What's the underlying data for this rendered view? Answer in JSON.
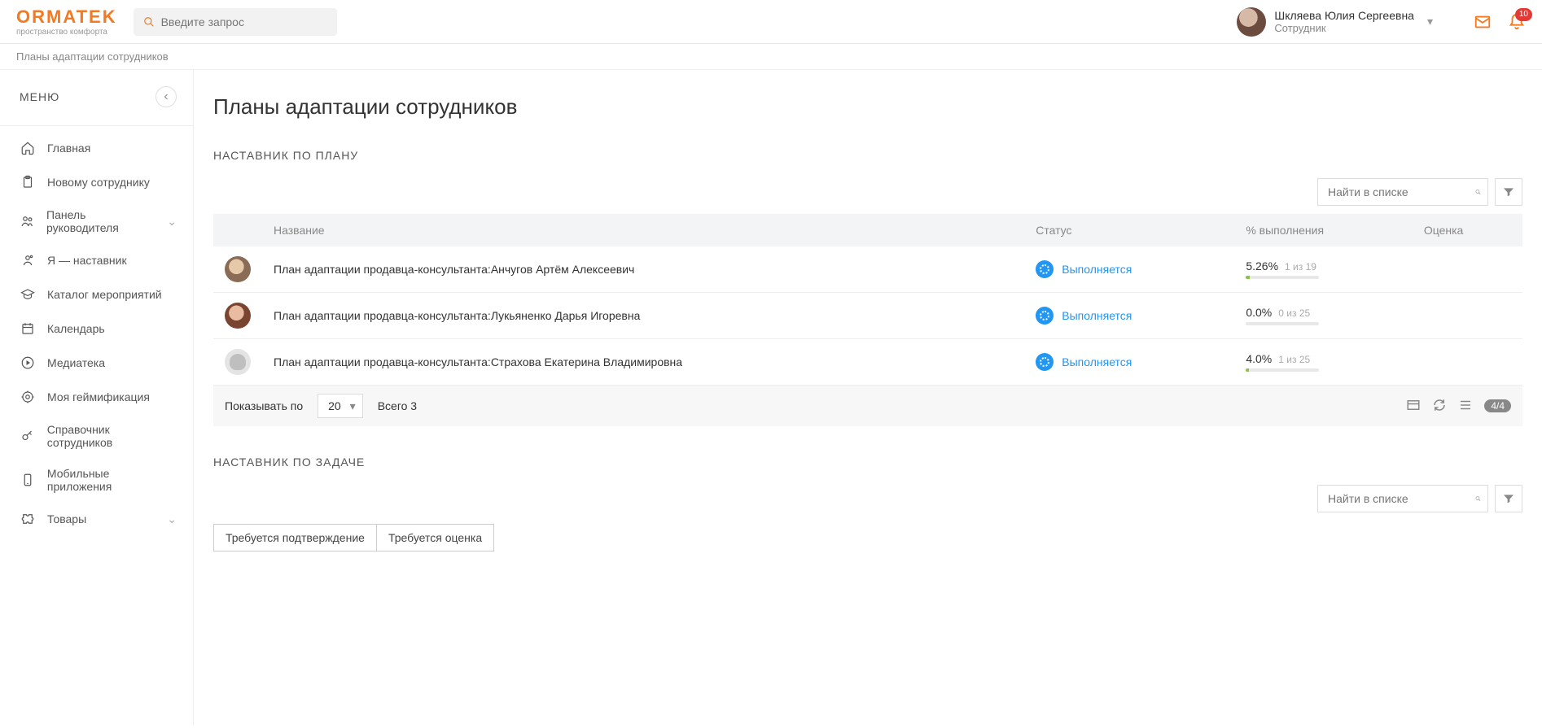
{
  "header": {
    "logo": "ORMATEK",
    "logo_sub": "пространство комфорта",
    "search_placeholder": "Введите запрос",
    "user_name": "Шкляева Юлия Сергеевна",
    "user_role": "Сотрудник",
    "notif_count": "10"
  },
  "breadcrumb": "Планы адаптации сотрудников",
  "sidebar": {
    "title": "МЕНЮ",
    "items": [
      {
        "icon": "home-icon",
        "label": "Главная",
        "expandable": false
      },
      {
        "icon": "clipboard-icon",
        "label": "Новому сотруднику",
        "expandable": false
      },
      {
        "icon": "people-icon",
        "label": "Панель руководителя",
        "expandable": true
      },
      {
        "icon": "mentor-icon",
        "label": "Я — наставник",
        "expandable": false
      },
      {
        "icon": "cap-icon",
        "label": "Каталог мероприятий",
        "expandable": false
      },
      {
        "icon": "calendar-icon",
        "label": "Календарь",
        "expandable": false
      },
      {
        "icon": "play-icon",
        "label": "Медиатека",
        "expandable": false
      },
      {
        "icon": "trophy-icon",
        "label": "Моя геймификация",
        "expandable": false
      },
      {
        "icon": "key-icon",
        "label": "Справочник сотрудников",
        "expandable": false
      },
      {
        "icon": "phone-icon",
        "label": "Мобильные приложения",
        "expandable": false
      },
      {
        "icon": "puzzle-icon",
        "label": "Товары",
        "expandable": true
      }
    ]
  },
  "page": {
    "title": "Планы адаптации сотрудников",
    "section1": {
      "title": "НАСТАВНИК ПО ПЛАНУ",
      "list_search_placeholder": "Найти в списке",
      "columns": {
        "name": "Название",
        "status": "Статус",
        "completion": "% выполнения",
        "grade": "Оценка"
      },
      "rows": [
        {
          "avatar": "av1",
          "title": "План адаптации продавца-консультанта:Анчугов Артём Алексеевич",
          "status": "Выполняется",
          "pct": "5.26%",
          "sub": "1 из 19",
          "fill": 5.26
        },
        {
          "avatar": "av2",
          "title": "План адаптации продавца-консультанта:Лукьяненко Дарья Игоревна",
          "status": "Выполняется",
          "pct": "0.0%",
          "sub": "0 из 25",
          "fill": 0
        },
        {
          "avatar": "av3",
          "title": "План адаптации продавца-консультанта:Страхова Екатерина Владимировна",
          "status": "Выполняется",
          "pct": "4.0%",
          "sub": "1 из 25",
          "fill": 4
        }
      ],
      "pager": {
        "show_label": "Показывать по",
        "per_page": "20",
        "total_label": "Всего 3",
        "pill": "4/4"
      }
    },
    "section2": {
      "title": "НАСТАВНИК ПО ЗАДАЧЕ",
      "list_search_placeholder": "Найти в списке",
      "tabs": [
        "Требуется подтверждение",
        "Требуется оценка"
      ]
    }
  }
}
